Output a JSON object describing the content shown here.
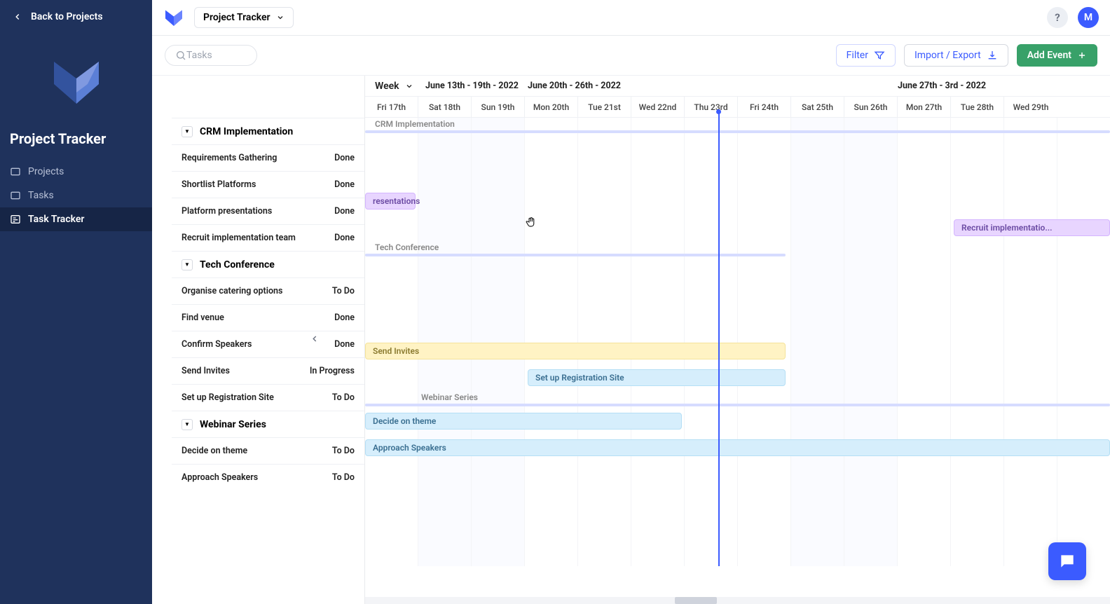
{
  "sidebar": {
    "back_label": "Back to Projects",
    "title": "Project Tracker",
    "items": [
      {
        "label": "Projects"
      },
      {
        "label": "Tasks"
      },
      {
        "label": "Task Tracker"
      }
    ]
  },
  "header": {
    "project_name": "Project Tracker",
    "avatar_letter": "M",
    "help_glyph": "?"
  },
  "toolbar": {
    "search_placeholder": "Tasks",
    "filter_label": "Filter",
    "import_label": "Import / Export",
    "add_label": "Add Event"
  },
  "timeline": {
    "scale_label": "Week",
    "ranges": [
      {
        "label": "June 13th - 19th - 2022"
      },
      {
        "label": "June 20th - 26th - 2022"
      },
      {
        "label": "June 27th - 3rd - 2022"
      }
    ],
    "days": [
      "Fri 17th",
      "Sat 18th",
      "Sun 19th",
      "Mon 20th",
      "Tue 21st",
      "Wed 22nd",
      "Thu 23rd",
      "Fri 24th",
      "Sat 25th",
      "Sun 26th",
      "Mon 27th",
      "Tue 28th",
      "Wed 29th"
    ]
  },
  "groups": [
    {
      "name": "CRM Implementation",
      "tasks": [
        {
          "name": "Requirements Gathering",
          "status": "Done"
        },
        {
          "name": "Shortlist Platforms",
          "status": "Done"
        },
        {
          "name": "Platform presentations",
          "status": "Done"
        },
        {
          "name": "Recruit implementation team",
          "status": "Done"
        }
      ]
    },
    {
      "name": "Tech Conference",
      "tasks": [
        {
          "name": "Organise catering options",
          "status": "To Do"
        },
        {
          "name": "Find venue",
          "status": "Done"
        },
        {
          "name": "Confirm Speakers",
          "status": "Done"
        },
        {
          "name": "Send Invites",
          "status": "In Progress"
        },
        {
          "name": "Set up Registration Site",
          "status": "To Do"
        }
      ]
    },
    {
      "name": "Webinar Series",
      "tasks": [
        {
          "name": "Decide on theme",
          "status": "To Do"
        },
        {
          "name": "Approach Speakers",
          "status": "To Do"
        }
      ]
    }
  ],
  "bars": {
    "presentations": "resentations",
    "recruit": "Recruit implementatio...",
    "send_invites": "Send Invites",
    "setup_reg": "Set up Registration Site",
    "decide_theme": "Decide on theme",
    "approach_speakers": "Approach Speakers",
    "webinar": "Webinar Series",
    "tech_conf": "Tech Conference",
    "crm": "CRM Implementation"
  }
}
